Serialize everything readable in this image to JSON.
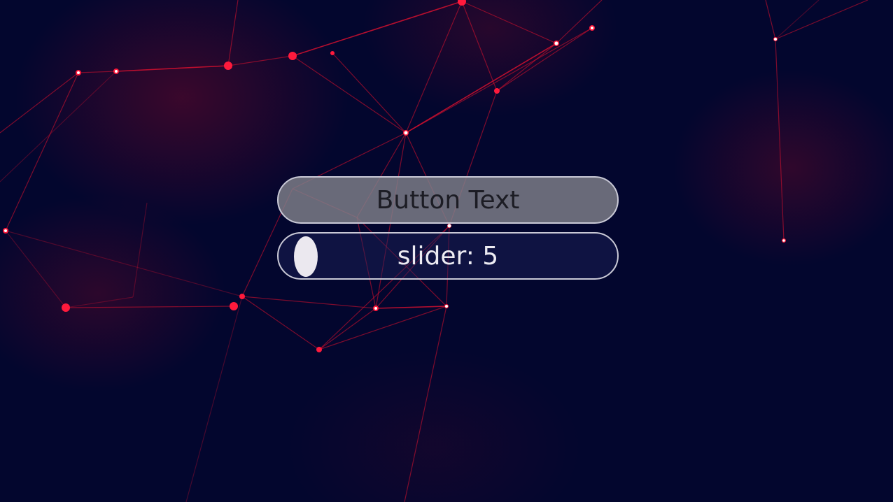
{
  "button": {
    "label": "Button Text"
  },
  "slider": {
    "label_prefix": "slider:",
    "value": "5"
  },
  "colors": {
    "background": "#03062e",
    "network": "#e0102e",
    "button_fill": "#80808a",
    "border": "#c9c9d6"
  }
}
